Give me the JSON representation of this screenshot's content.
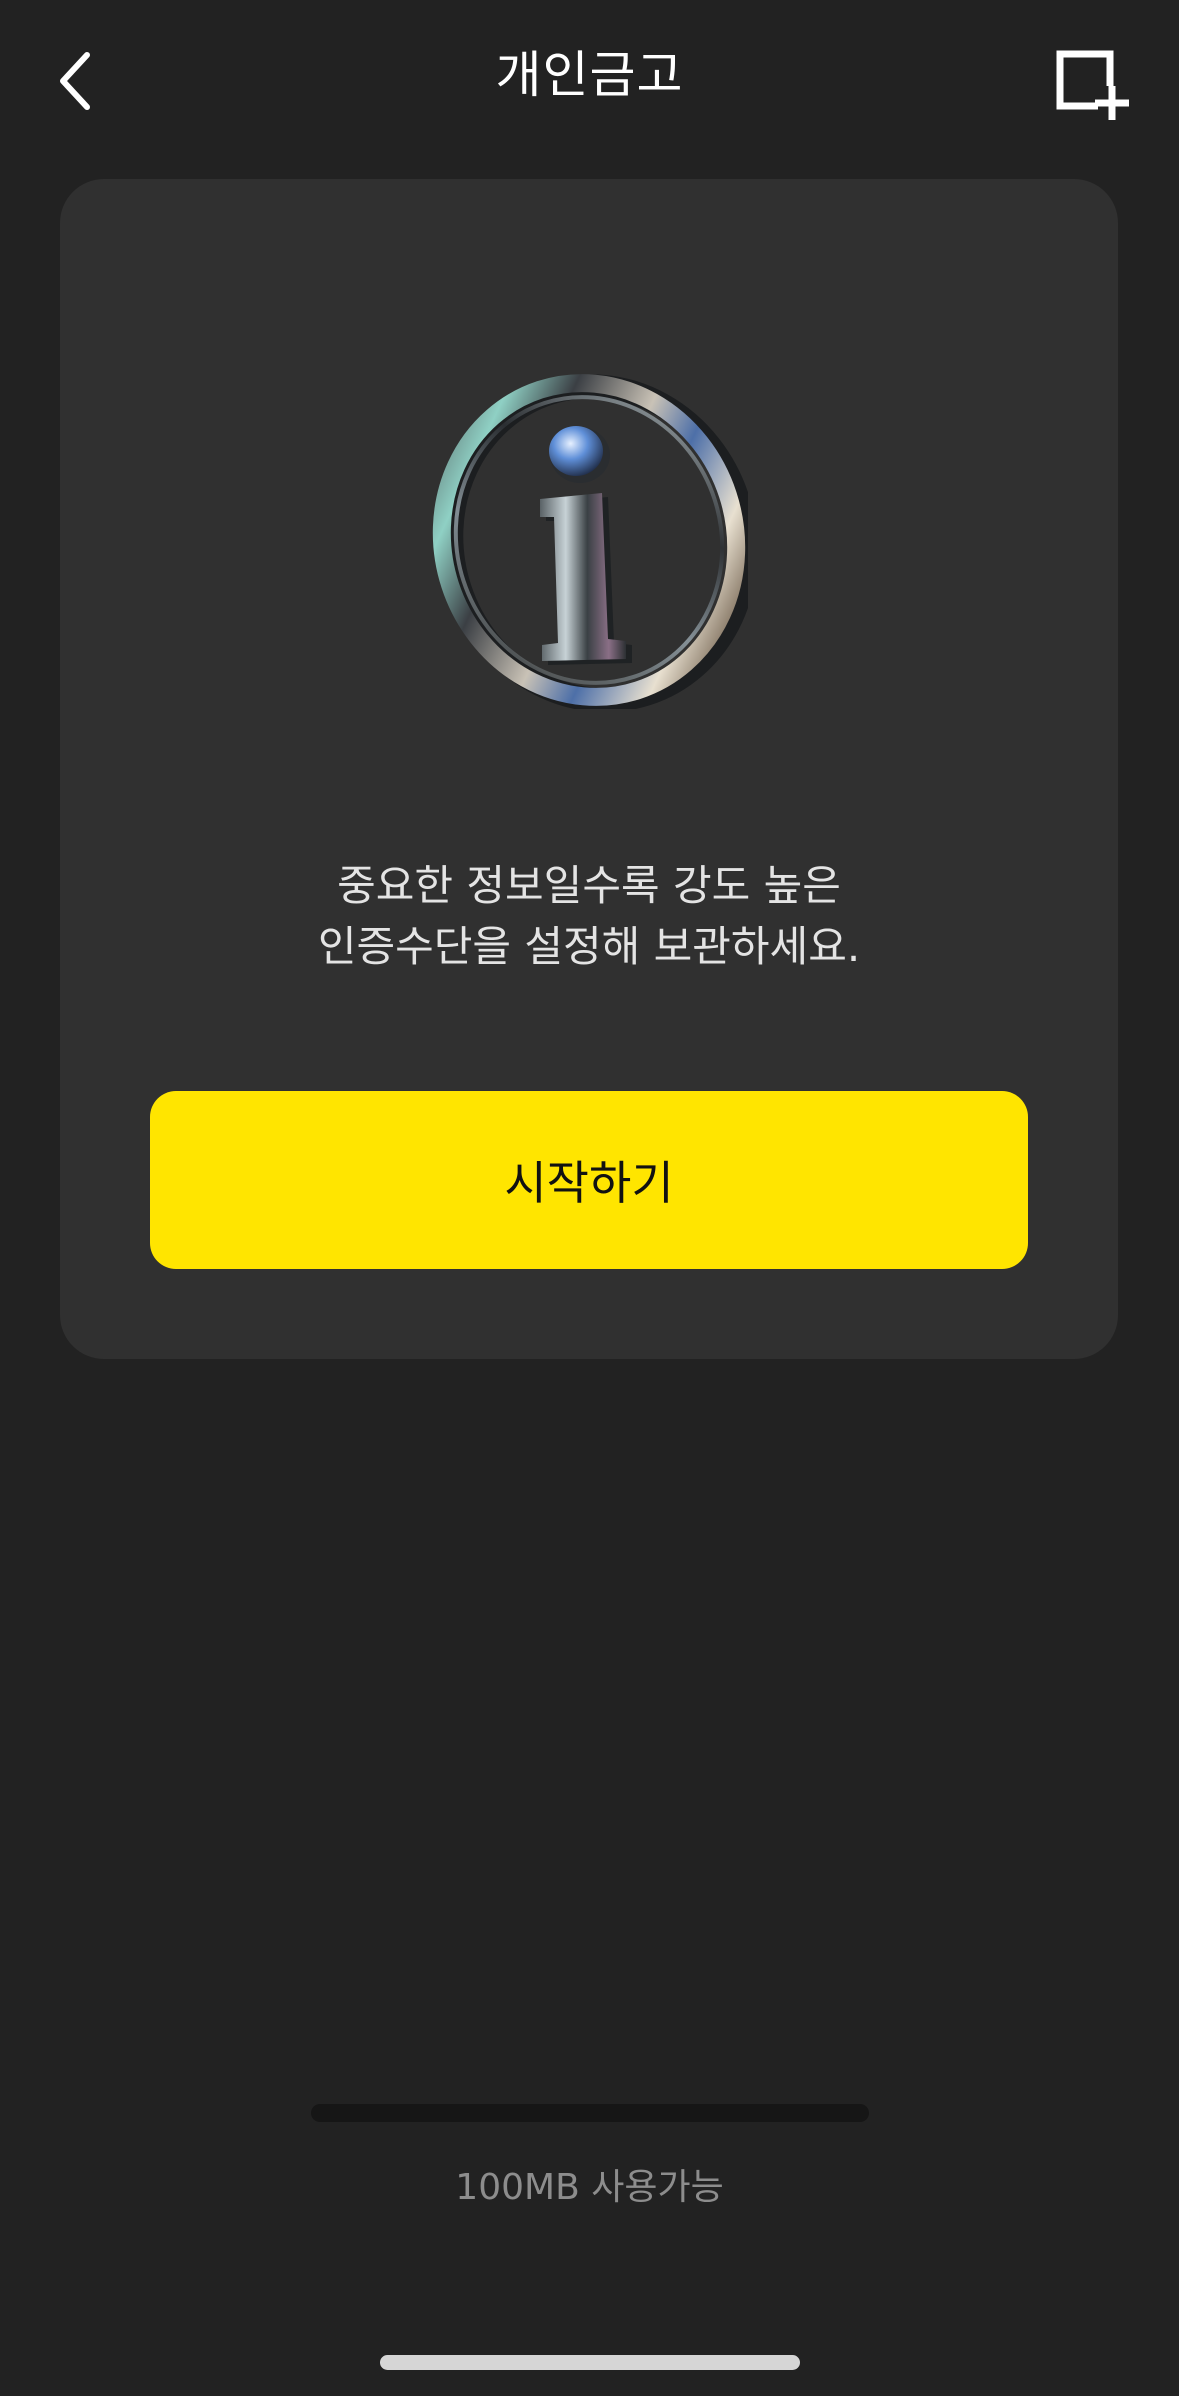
{
  "header": {
    "title": "개인금고",
    "back_icon": "chevron-left-icon",
    "add_icon": "add-square-icon"
  },
  "card": {
    "illustration_icon": "info-icon",
    "message_line1": "중요한 정보일수록 강도 높은",
    "message_line2": "인증수단을 설정해 보관하세요.",
    "start_button_label": "시작하기"
  },
  "storage": {
    "used_fraction": 0.0,
    "label": "100MB 사용가능"
  },
  "colors": {
    "background": "#222222",
    "card": "#303030",
    "accent": "#FFE500",
    "muted_text": "#8d8d8d"
  }
}
